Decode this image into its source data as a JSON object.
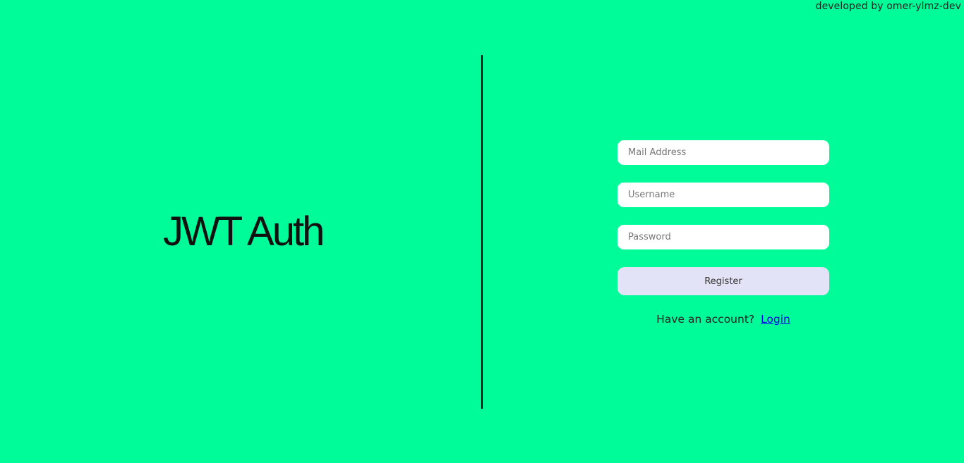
{
  "footer": {
    "credit": "developed by omer-ylmz-dev"
  },
  "brand": {
    "title": "JWT Auth"
  },
  "form": {
    "email_placeholder": "Mail Address",
    "username_placeholder": "Username",
    "password_placeholder": "Password",
    "submit_label": "Register",
    "prompt_text": "Have an account?",
    "login_link": "Login"
  },
  "colors": {
    "background": "#00fc99",
    "button": "#e3e3f8",
    "link": "#0000ee"
  }
}
